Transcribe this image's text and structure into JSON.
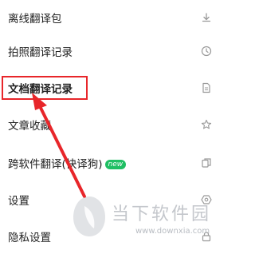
{
  "menu": {
    "items": [
      {
        "label": "离线翻译包",
        "icon": "download-icon"
      },
      {
        "label": "拍照翻译记录",
        "icon": "clock-icon"
      },
      {
        "label": "文档翻译记录",
        "icon": "document-icon",
        "highlighted": true
      },
      {
        "label": "文章收藏",
        "icon": "star-icon"
      },
      {
        "label": "跨软件翻译(快译狗)",
        "icon": "copy-icon",
        "badge": "new"
      },
      {
        "label": "设置",
        "icon": "settings-hexagon-icon"
      },
      {
        "label": "隐私设置",
        "icon": "lock-icon"
      }
    ]
  },
  "watermark": {
    "brand": "当下软件园",
    "url": "www.downxia.com"
  },
  "colors": {
    "highlight": "#e8262a",
    "badge": "#1fbf63",
    "text": "#222222",
    "icon": "#999999"
  }
}
